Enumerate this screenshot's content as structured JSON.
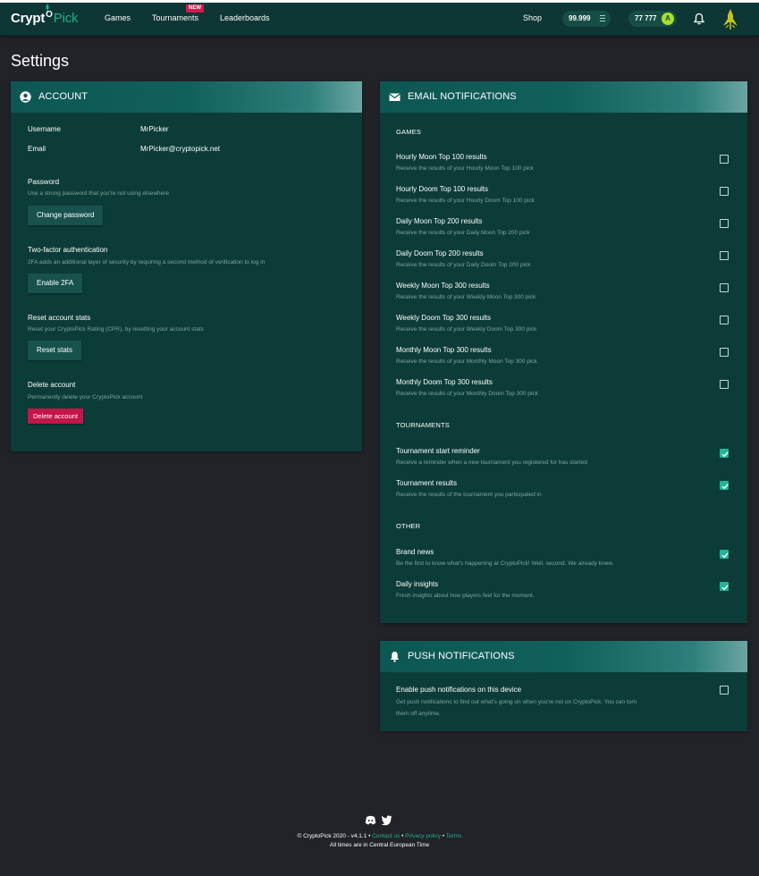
{
  "nav": {
    "logo_main": "Crypt",
    "logo_o": "O",
    "logo_pick": "Pick",
    "links": [
      "Games",
      "Tournaments",
      "Leaderboards"
    ],
    "new_badge": "NEW",
    "shop": "Shop",
    "balance1": "99.999",
    "balance2": "77 777",
    "coin_symbol": "A"
  },
  "page_title": "Settings",
  "account": {
    "title": "ACCOUNT",
    "username_label": "Username",
    "username_value": "MrPicker",
    "email_label": "Email",
    "email_value": "MrPicker@cryptopick.net",
    "password_title": "Password",
    "password_desc": "Use a strong password that you're not using elsewhere",
    "password_button": "Change password",
    "twofa_title": "Two-factor authentication",
    "twofa_desc": "2FA adds an additional layer of security by requiring a second method of verification to log in",
    "twofa_button": "Enable 2FA",
    "reset_title": "Reset account stats",
    "reset_desc": "Reset your CryptoPick Rating (CPR), by resetting your account stats",
    "reset_button": "Reset stats",
    "delete_title": "Delete account",
    "delete_desc": "Permanently delete your CryptoPick account",
    "delete_button": "Delete account"
  },
  "email": {
    "title": "EMAIL NOTIFICATIONS",
    "games_head": "GAMES",
    "games": [
      {
        "title": "Hourly Moon Top 100 results",
        "desc": "Receive the results of your Hourly Moon Top 100 pick",
        "checked": false
      },
      {
        "title": "Hourly Doom Top 100 results",
        "desc": "Receive the results of your Hourly Doom Top 100 pick",
        "checked": false
      },
      {
        "title": "Daily Moon Top 200 results",
        "desc": "Receive the results of your Daily Moon Top 200 pick",
        "checked": false
      },
      {
        "title": "Daily Doom Top 200 results",
        "desc": "Receive the results of your Daily Doom Top 200 pick",
        "checked": false
      },
      {
        "title": "Weekly Moon Top 300 results",
        "desc": "Receive the results of your Weekly Moon Top 300 pick",
        "checked": false
      },
      {
        "title": "Weekly Doom Top 300 results",
        "desc": "Receive the results of your Weekly Doom Top 300 pick",
        "checked": false
      },
      {
        "title": "Monthly Moon Top 300 results",
        "desc": "Receive the results of your Monthly Moon Top 300 pick",
        "checked": false
      },
      {
        "title": "Monthly Doom Top 300 results",
        "desc": "Receive the results of your Monthly Doom Top 300 pick",
        "checked": false
      }
    ],
    "tournaments_head": "TOURNAMENTS",
    "tournaments": [
      {
        "title": "Tournament start reminder",
        "desc": "Receive a reminder when a new tournament you registered for has started",
        "checked": true
      },
      {
        "title": "Tournament results",
        "desc": "Receive the results of the tournament you participated in",
        "checked": true
      }
    ],
    "other_head": "OTHER",
    "other": [
      {
        "title": "Brand news",
        "desc": "Be the first to know what's happening at CryptoPick! Well, second. We already knew.",
        "checked": true
      },
      {
        "title": "Daily insights",
        "desc": "Fresh insights about how players feel for the moment.",
        "checked": true
      }
    ]
  },
  "push": {
    "title": "PUSH NOTIFICATIONS",
    "row_title": "Enable push notifications on this device",
    "row_desc_1": "Get push notifications to find out what's going on when you're not on CryptoPick. You can turn",
    "row_desc_2": "them off anytime.",
    "checked": false
  },
  "footer": {
    "copyright": "© CryptoPick 2020 - v4.1.1",
    "bullet": "•",
    "contact": "Contact us",
    "privacy": "Privacy policy",
    "terms": "Terms",
    "timezone": "All times are in Central European Time"
  },
  "colors": {
    "background": "#222329",
    "nav": "#0d3634",
    "panel": "#0c3c38",
    "accent": "#1fb08a",
    "danger": "#c2154a",
    "badge": "#d4194f"
  },
  "icons": [
    "user-circle-icon",
    "envelope-icon",
    "bell-icon",
    "discord-icon",
    "twitter-icon",
    "check-icon",
    "rocket-icon",
    "rocket-avatar-icon"
  ]
}
